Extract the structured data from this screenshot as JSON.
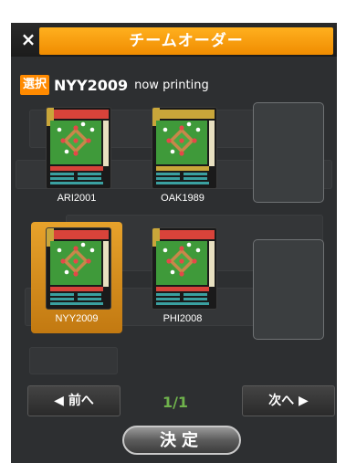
{
  "dialog": {
    "close_label": "×",
    "title": "チームオーダー"
  },
  "selection": {
    "badge": "選択",
    "team": "NYY2009",
    "status": "now printing"
  },
  "cards": [
    {
      "label": "ARI2001",
      "selected": false,
      "accent": "#d8433a"
    },
    {
      "label": "OAK1989",
      "selected": false,
      "accent": "#c9a63a"
    },
    {
      "label": "NYY2009",
      "selected": true,
      "accent": "#d8433a"
    },
    {
      "label": "PHI2008",
      "selected": false,
      "accent": "#d8433a"
    }
  ],
  "pagination": {
    "prev_label": "◀ 前へ",
    "indicator": "1/1",
    "next_label": "次へ ▶"
  },
  "confirm_label": "決定",
  "colors": {
    "accent": "#f59a10",
    "panel": "#2d2f31",
    "page_indicator": "#6fb24c"
  }
}
